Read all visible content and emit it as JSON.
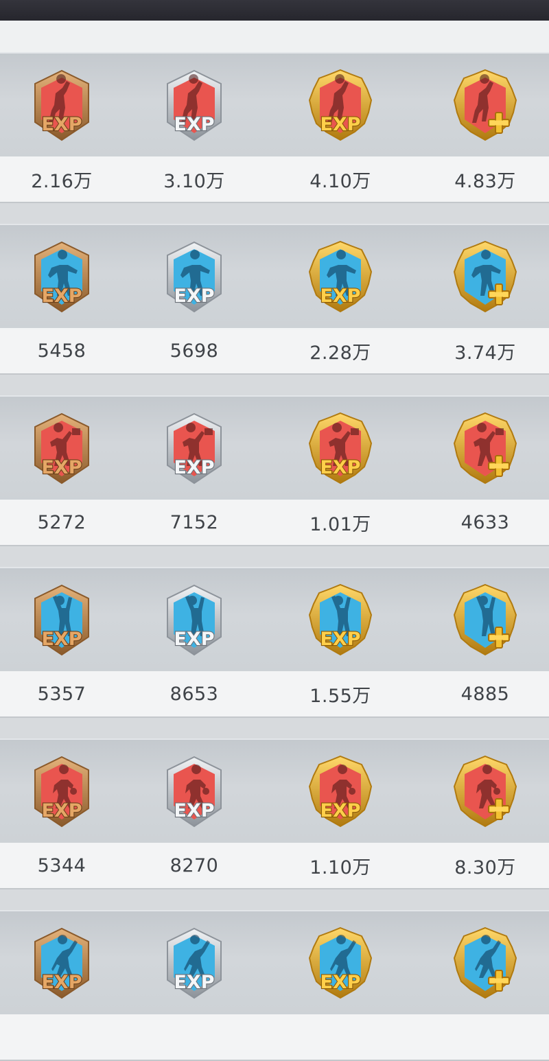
{
  "exp_label": "EXP",
  "tiers": [
    "bronze",
    "silver",
    "gold",
    "gold-plus"
  ],
  "tier_colors": {
    "bronze": {
      "frame": "#c48a4f",
      "frame_dark": "#8a5a2b",
      "frame_light": "#e4b27a"
    },
    "silver": {
      "frame": "#c9cdd2",
      "frame_dark": "#8d939a",
      "frame_light": "#f1f3f5"
    },
    "gold": {
      "frame": "#f0b429",
      "frame_dark": "#b07a10",
      "frame_light": "#ffd86a"
    },
    "gold-plus": {
      "frame": "#f0b429",
      "frame_dark": "#b07a10",
      "frame_light": "#ffd86a"
    }
  },
  "badge_colors": {
    "red": "#e9554f",
    "blue": "#3eb2e3"
  },
  "rows": [
    {
      "badge_color": "red",
      "figure": "shooter-icon",
      "values": [
        "2.16万",
        "3.10万",
        "4.10万",
        "4.83万"
      ]
    },
    {
      "badge_color": "blue",
      "figure": "defender-icon",
      "values": [
        "5458",
        "5698",
        "2.28万",
        "3.74万"
      ]
    },
    {
      "badge_color": "red",
      "figure": "dunker-icon",
      "values": [
        "5272",
        "7152",
        "1.01万",
        "4633"
      ]
    },
    {
      "badge_color": "blue",
      "figure": "blocker-icon",
      "values": [
        "5357",
        "8653",
        "1.55万",
        "4885"
      ]
    },
    {
      "badge_color": "red",
      "figure": "dribbler-icon",
      "values": [
        "5344",
        "8270",
        "1.10万",
        "8.30万"
      ]
    },
    {
      "badge_color": "blue",
      "figure": "layup-icon",
      "values": []
    }
  ]
}
